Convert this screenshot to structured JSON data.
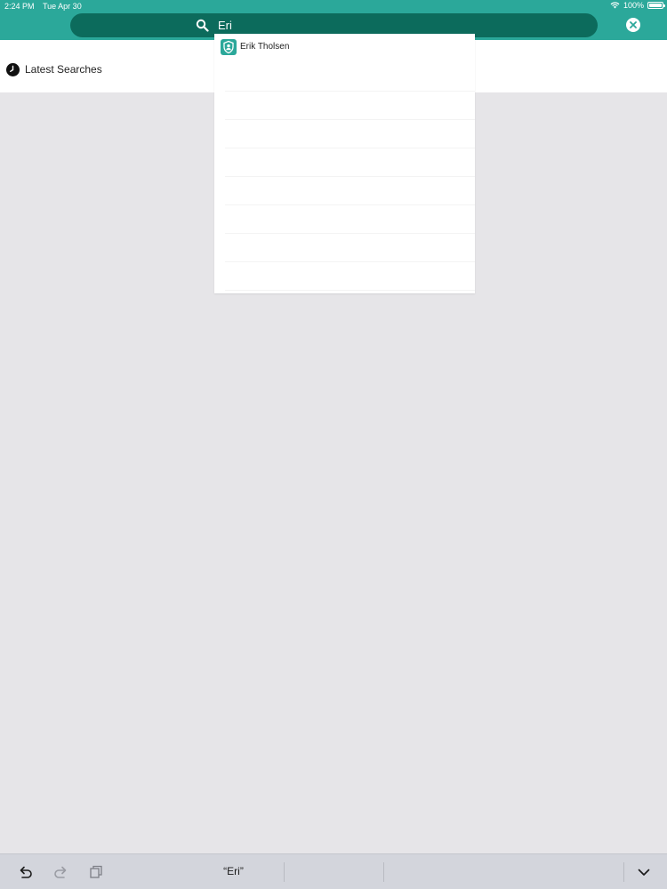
{
  "status_bar": {
    "time": "2:24 PM",
    "date": "Tue Apr 30",
    "battery": "100%"
  },
  "search": {
    "value": "Eri",
    "placeholder": ""
  },
  "latest_searches": {
    "label": "Latest Searches"
  },
  "suggestions": [
    {
      "label": "Erik Tholsen"
    }
  ],
  "keyboard_bar": {
    "prediction": "“Eri”"
  },
  "colors": {
    "header": "#2ba89a",
    "search_pill": "#0c6b5c",
    "background": "#e6e5e8",
    "keyboard_bar": "#d3d5dc"
  }
}
